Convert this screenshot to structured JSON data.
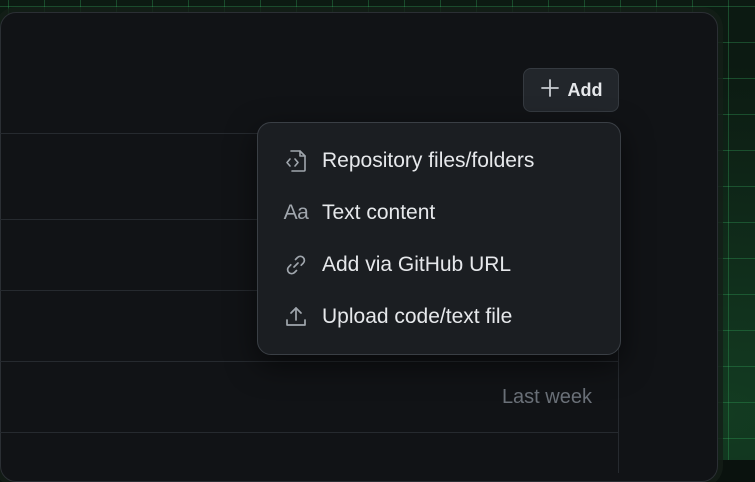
{
  "toolbar": {
    "add_label": "Add",
    "add_icon": "plus-icon"
  },
  "menu": {
    "items": [
      {
        "label": "Repository files/folders",
        "icon": "file-code-icon"
      },
      {
        "label": "Text content",
        "icon": "typography-icon",
        "icon_text": "Aa"
      },
      {
        "label": "Add via GitHub URL",
        "icon": "link-icon"
      },
      {
        "label": "Upload code/text file",
        "icon": "upload-icon"
      }
    ]
  },
  "list": {
    "timestamp": "Last week"
  },
  "colors": {
    "accent_grid": "#3cc86e",
    "panel": "#111316",
    "menu": "#1b1e22"
  }
}
